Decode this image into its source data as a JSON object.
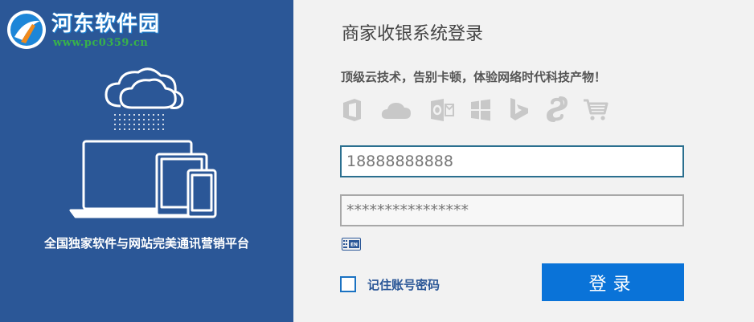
{
  "watermark": {
    "site_name": "河东软件园",
    "url": "www.pc0359.cn"
  },
  "left_panel": {
    "tagline": "全国独家软件与网站完美通讯营销平台",
    "background_color": "#2b5797"
  },
  "login": {
    "title": "商家收银系统登录",
    "slogan": "顶级云技术，告别卡顿，体验网络时代科技产物！",
    "feature_icons": [
      "office-icon",
      "onedrive-cloud-icon",
      "outlook-icon",
      "windows-icon",
      "bing-icon",
      "skype-icon",
      "shopping-cart-icon"
    ],
    "phone_value": "18888888888",
    "password_value": "****************",
    "keyboard_icon": "cn-en-keyboard-icon",
    "remember_label": "记住账号密码",
    "submit_label": "登录",
    "accent_color": "#0a73d8"
  }
}
